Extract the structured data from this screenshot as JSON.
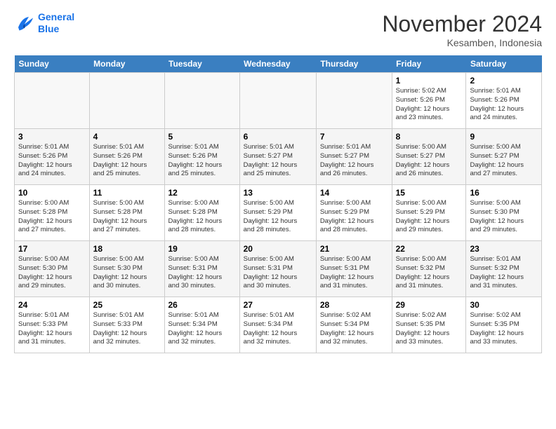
{
  "logo": {
    "line1": "General",
    "line2": "Blue"
  },
  "title": "November 2024",
  "subtitle": "Kesamben, Indonesia",
  "weekdays": [
    "Sunday",
    "Monday",
    "Tuesday",
    "Wednesday",
    "Thursday",
    "Friday",
    "Saturday"
  ],
  "weeks": [
    [
      {
        "day": "",
        "info": ""
      },
      {
        "day": "",
        "info": ""
      },
      {
        "day": "",
        "info": ""
      },
      {
        "day": "",
        "info": ""
      },
      {
        "day": "",
        "info": ""
      },
      {
        "day": "1",
        "info": "Sunrise: 5:02 AM\nSunset: 5:26 PM\nDaylight: 12 hours\nand 23 minutes."
      },
      {
        "day": "2",
        "info": "Sunrise: 5:01 AM\nSunset: 5:26 PM\nDaylight: 12 hours\nand 24 minutes."
      }
    ],
    [
      {
        "day": "3",
        "info": "Sunrise: 5:01 AM\nSunset: 5:26 PM\nDaylight: 12 hours\nand 24 minutes."
      },
      {
        "day": "4",
        "info": "Sunrise: 5:01 AM\nSunset: 5:26 PM\nDaylight: 12 hours\nand 25 minutes."
      },
      {
        "day": "5",
        "info": "Sunrise: 5:01 AM\nSunset: 5:26 PM\nDaylight: 12 hours\nand 25 minutes."
      },
      {
        "day": "6",
        "info": "Sunrise: 5:01 AM\nSunset: 5:27 PM\nDaylight: 12 hours\nand 25 minutes."
      },
      {
        "day": "7",
        "info": "Sunrise: 5:01 AM\nSunset: 5:27 PM\nDaylight: 12 hours\nand 26 minutes."
      },
      {
        "day": "8",
        "info": "Sunrise: 5:00 AM\nSunset: 5:27 PM\nDaylight: 12 hours\nand 26 minutes."
      },
      {
        "day": "9",
        "info": "Sunrise: 5:00 AM\nSunset: 5:27 PM\nDaylight: 12 hours\nand 27 minutes."
      }
    ],
    [
      {
        "day": "10",
        "info": "Sunrise: 5:00 AM\nSunset: 5:28 PM\nDaylight: 12 hours\nand 27 minutes."
      },
      {
        "day": "11",
        "info": "Sunrise: 5:00 AM\nSunset: 5:28 PM\nDaylight: 12 hours\nand 27 minutes."
      },
      {
        "day": "12",
        "info": "Sunrise: 5:00 AM\nSunset: 5:28 PM\nDaylight: 12 hours\nand 28 minutes."
      },
      {
        "day": "13",
        "info": "Sunrise: 5:00 AM\nSunset: 5:29 PM\nDaylight: 12 hours\nand 28 minutes."
      },
      {
        "day": "14",
        "info": "Sunrise: 5:00 AM\nSunset: 5:29 PM\nDaylight: 12 hours\nand 28 minutes."
      },
      {
        "day": "15",
        "info": "Sunrise: 5:00 AM\nSunset: 5:29 PM\nDaylight: 12 hours\nand 29 minutes."
      },
      {
        "day": "16",
        "info": "Sunrise: 5:00 AM\nSunset: 5:30 PM\nDaylight: 12 hours\nand 29 minutes."
      }
    ],
    [
      {
        "day": "17",
        "info": "Sunrise: 5:00 AM\nSunset: 5:30 PM\nDaylight: 12 hours\nand 29 minutes."
      },
      {
        "day": "18",
        "info": "Sunrise: 5:00 AM\nSunset: 5:30 PM\nDaylight: 12 hours\nand 30 minutes."
      },
      {
        "day": "19",
        "info": "Sunrise: 5:00 AM\nSunset: 5:31 PM\nDaylight: 12 hours\nand 30 minutes."
      },
      {
        "day": "20",
        "info": "Sunrise: 5:00 AM\nSunset: 5:31 PM\nDaylight: 12 hours\nand 30 minutes."
      },
      {
        "day": "21",
        "info": "Sunrise: 5:00 AM\nSunset: 5:31 PM\nDaylight: 12 hours\nand 31 minutes."
      },
      {
        "day": "22",
        "info": "Sunrise: 5:00 AM\nSunset: 5:32 PM\nDaylight: 12 hours\nand 31 minutes."
      },
      {
        "day": "23",
        "info": "Sunrise: 5:01 AM\nSunset: 5:32 PM\nDaylight: 12 hours\nand 31 minutes."
      }
    ],
    [
      {
        "day": "24",
        "info": "Sunrise: 5:01 AM\nSunset: 5:33 PM\nDaylight: 12 hours\nand 31 minutes."
      },
      {
        "day": "25",
        "info": "Sunrise: 5:01 AM\nSunset: 5:33 PM\nDaylight: 12 hours\nand 32 minutes."
      },
      {
        "day": "26",
        "info": "Sunrise: 5:01 AM\nSunset: 5:34 PM\nDaylight: 12 hours\nand 32 minutes."
      },
      {
        "day": "27",
        "info": "Sunrise: 5:01 AM\nSunset: 5:34 PM\nDaylight: 12 hours\nand 32 minutes."
      },
      {
        "day": "28",
        "info": "Sunrise: 5:02 AM\nSunset: 5:34 PM\nDaylight: 12 hours\nand 32 minutes."
      },
      {
        "day": "29",
        "info": "Sunrise: 5:02 AM\nSunset: 5:35 PM\nDaylight: 12 hours\nand 33 minutes."
      },
      {
        "day": "30",
        "info": "Sunrise: 5:02 AM\nSunset: 5:35 PM\nDaylight: 12 hours\nand 33 minutes."
      }
    ]
  ]
}
